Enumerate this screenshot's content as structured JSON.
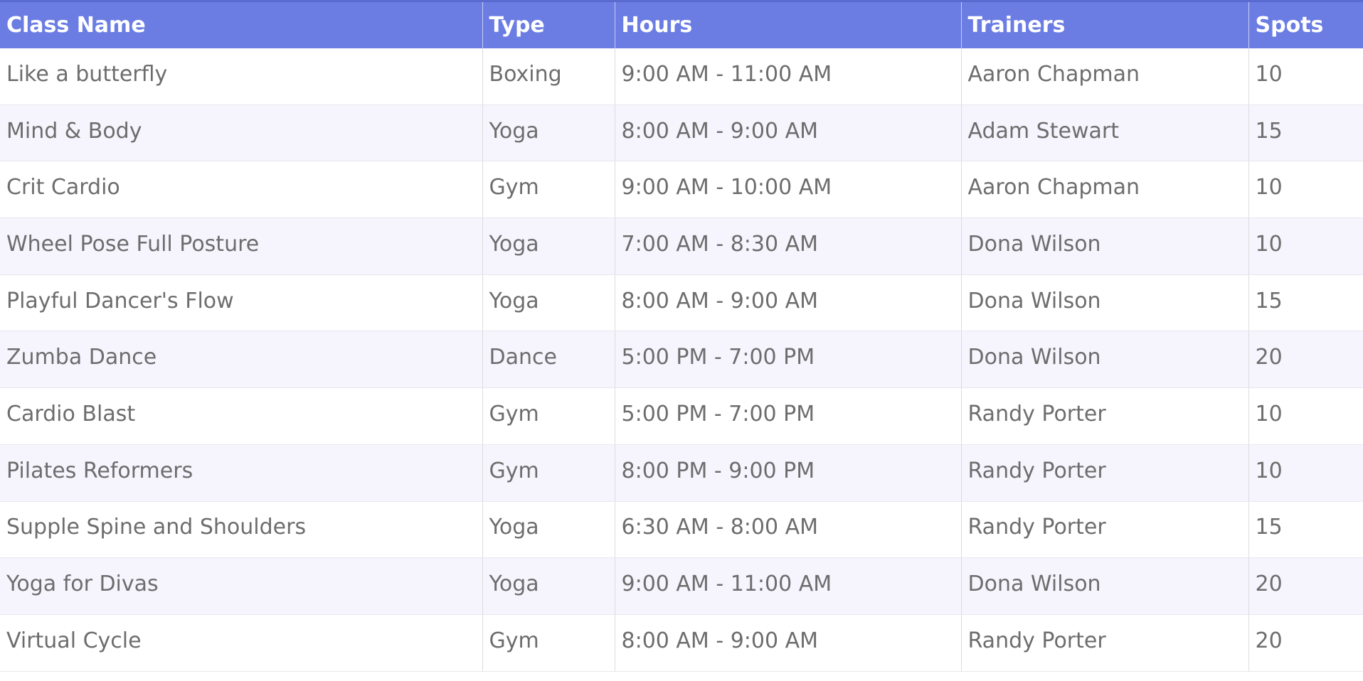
{
  "columns": [
    "Class Name",
    "Type",
    "Hours",
    "Trainers",
    "Spots"
  ],
  "rows": [
    [
      "Like a butterfly",
      "Boxing",
      "9:00 AM - 11:00 AM",
      "Aaron Chapman",
      "10"
    ],
    [
      "Mind & Body",
      "Yoga",
      "8:00 AM - 9:00 AM",
      "Adam Stewart",
      "15"
    ],
    [
      "Crit Cardio",
      "Gym",
      "9:00 AM - 10:00 AM",
      "Aaron Chapman",
      "10"
    ],
    [
      "Wheel Pose Full Posture",
      "Yoga",
      "7:00 AM - 8:30 AM",
      "Dona Wilson",
      "10"
    ],
    [
      "Playful Dancer's Flow",
      "Yoga",
      "8:00 AM - 9:00 AM",
      "Dona Wilson",
      "15"
    ],
    [
      "Zumba Dance",
      "Dance",
      "5:00 PM - 7:00 PM",
      "Dona Wilson",
      "20"
    ],
    [
      "Cardio Blast",
      "Gym",
      "5:00 PM - 7:00 PM",
      "Randy Porter",
      "10"
    ],
    [
      "Pilates Reformers",
      "Gym",
      "8:00 PM - 9:00 PM",
      "Randy Porter",
      "10"
    ],
    [
      "Supple Spine and Shoulders",
      "Yoga",
      "6:30 AM - 8:00 AM",
      "Randy Porter",
      "15"
    ],
    [
      "Yoga for Divas",
      "Yoga",
      "9:00 AM - 11:00 AM",
      "Dona Wilson",
      "20"
    ],
    [
      "Virtual Cycle",
      "Gym",
      "8:00 AM - 9:00 AM",
      "Randy Porter",
      "20"
    ]
  ],
  "colors": {
    "header_bg": "#6b7de3",
    "header_text": "#ffffff",
    "row_alt_bg": "#f6f5fe",
    "cell_text": "#6d6d6d"
  }
}
